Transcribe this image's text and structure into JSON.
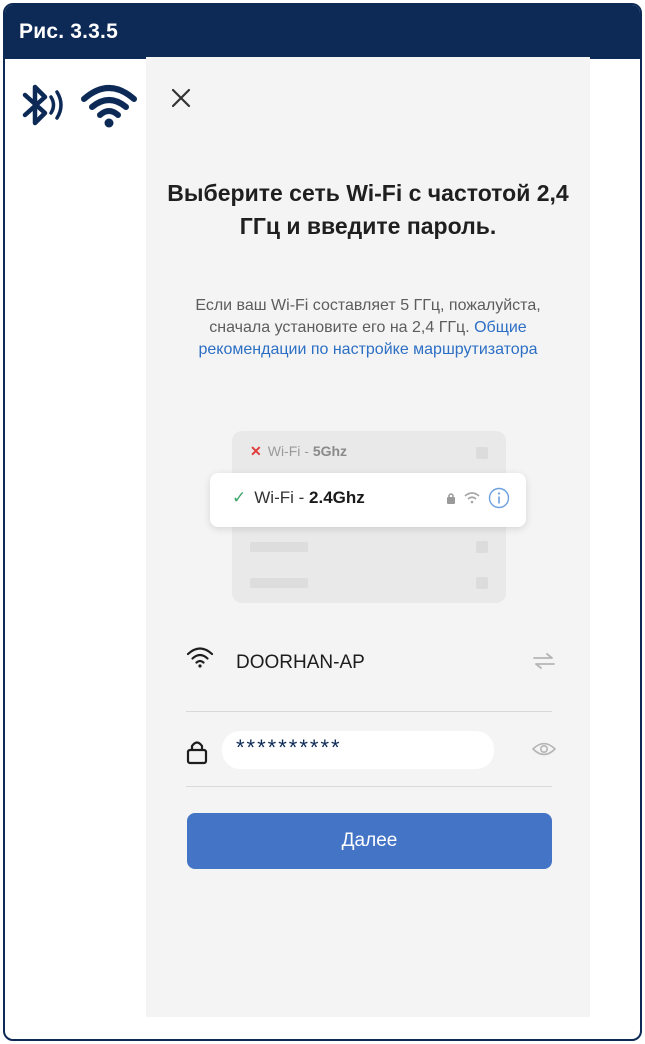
{
  "figure": {
    "caption": "Рис. 3.3.5"
  },
  "side_icons": [
    "bluetooth-icon",
    "wifi-icon"
  ],
  "screen": {
    "close_icon": "close-icon",
    "title": "Выберите сеть Wi-Fi с частотой 2,4 ГГц и введите пароль.",
    "description_text": "Если ваш Wi-Fi составляет 5 ГГц, пожалуйста, сначала установите его на 2,4 ГГц.",
    "description_link": "Общие рекомендации по настройке маршрутизатора",
    "illustration": {
      "band_5": {
        "prefix": "Wi-Fi - ",
        "band": "5Ghz",
        "status": "unsupported"
      },
      "band_24": {
        "prefix": "Wi-Fi - ",
        "band": "2.4Ghz",
        "status": "supported"
      }
    },
    "network": {
      "ssid": "DOORHAN-AP"
    },
    "password": {
      "value": "**********"
    },
    "next_button": {
      "label": "Далее"
    },
    "colors": {
      "header": "#0d2a57",
      "accent": "#4474c6",
      "link": "#2c6fc4"
    }
  }
}
